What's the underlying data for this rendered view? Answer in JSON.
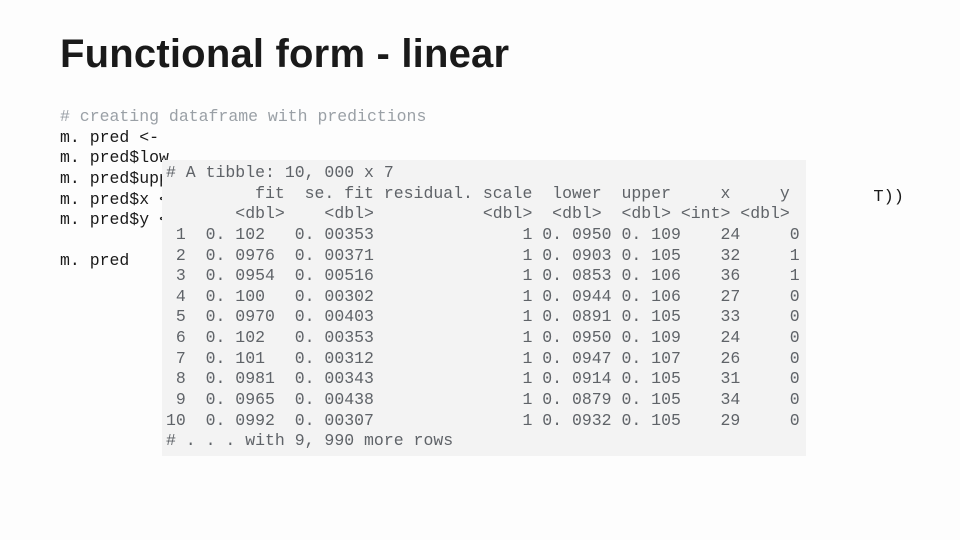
{
  "title": "Functional form - linear",
  "bgcode": {
    "comment": "# creating dataframe with predictions",
    "l1": "m. pred <-",
    "l2": "m. pred$low",
    "l3": "m. pred$upp",
    "l4": "m. pred$x <",
    "l5": "m. pred$y <",
    "gap": "",
    "l6": "m. pred"
  },
  "trail": "T))",
  "tibble": {
    "header": "# A tibble: 10, 000 x 7",
    "colnames": "         fit  se. fit residual. scale  lower  upper     x     y",
    "coltypes": "       <dbl>    <dbl>           <dbl>  <dbl>  <dbl> <int> <dbl>",
    "r1": " 1  0. 102   0. 00353               1 0. 0950 0. 109    24     0",
    "r2": " 2  0. 0976  0. 00371               1 0. 0903 0. 105    32     1",
    "r3": " 3  0. 0954  0. 00516               1 0. 0853 0. 106    36     1",
    "r4": " 4  0. 100   0. 00302               1 0. 0944 0. 106    27     0",
    "r5": " 5  0. 0970  0. 00403               1 0. 0891 0. 105    33     0",
    "r6": " 6  0. 102   0. 00353               1 0. 0950 0. 109    24     0",
    "r7": " 7  0. 101   0. 00312               1 0. 0947 0. 107    26     0",
    "r8": " 8  0. 0981  0. 00343               1 0. 0914 0. 105    31     0",
    "r9": " 9  0. 0965  0. 00438               1 0. 0879 0. 105    34     0",
    "r10": "10  0. 0992  0. 00307               1 0. 0932 0. 105    29     0",
    "footer": "# . . . with 9, 990 more rows"
  }
}
